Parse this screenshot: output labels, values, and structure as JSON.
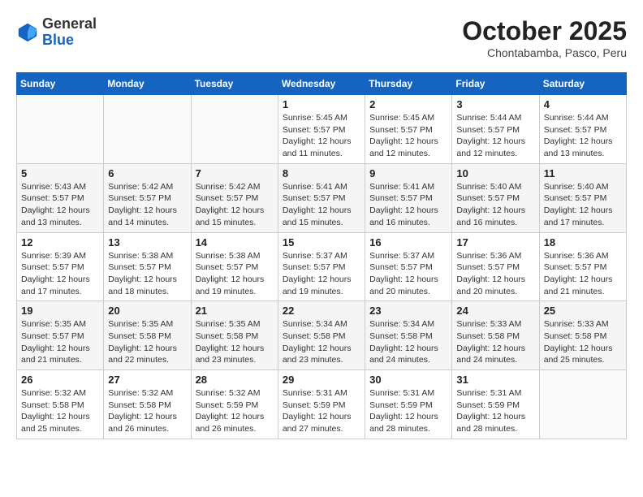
{
  "header": {
    "logo": {
      "general": "General",
      "blue": "Blue"
    },
    "month": "October 2025",
    "location": "Chontabamba, Pasco, Peru"
  },
  "weekdays": [
    "Sunday",
    "Monday",
    "Tuesday",
    "Wednesday",
    "Thursday",
    "Friday",
    "Saturday"
  ],
  "weeks": [
    [
      {
        "day": "",
        "info": ""
      },
      {
        "day": "",
        "info": ""
      },
      {
        "day": "",
        "info": ""
      },
      {
        "day": "1",
        "info": "Sunrise: 5:45 AM\nSunset: 5:57 PM\nDaylight: 12 hours\nand 11 minutes."
      },
      {
        "day": "2",
        "info": "Sunrise: 5:45 AM\nSunset: 5:57 PM\nDaylight: 12 hours\nand 12 minutes."
      },
      {
        "day": "3",
        "info": "Sunrise: 5:44 AM\nSunset: 5:57 PM\nDaylight: 12 hours\nand 12 minutes."
      },
      {
        "day": "4",
        "info": "Sunrise: 5:44 AM\nSunset: 5:57 PM\nDaylight: 12 hours\nand 13 minutes."
      }
    ],
    [
      {
        "day": "5",
        "info": "Sunrise: 5:43 AM\nSunset: 5:57 PM\nDaylight: 12 hours\nand 13 minutes."
      },
      {
        "day": "6",
        "info": "Sunrise: 5:42 AM\nSunset: 5:57 PM\nDaylight: 12 hours\nand 14 minutes."
      },
      {
        "day": "7",
        "info": "Sunrise: 5:42 AM\nSunset: 5:57 PM\nDaylight: 12 hours\nand 15 minutes."
      },
      {
        "day": "8",
        "info": "Sunrise: 5:41 AM\nSunset: 5:57 PM\nDaylight: 12 hours\nand 15 minutes."
      },
      {
        "day": "9",
        "info": "Sunrise: 5:41 AM\nSunset: 5:57 PM\nDaylight: 12 hours\nand 16 minutes."
      },
      {
        "day": "10",
        "info": "Sunrise: 5:40 AM\nSunset: 5:57 PM\nDaylight: 12 hours\nand 16 minutes."
      },
      {
        "day": "11",
        "info": "Sunrise: 5:40 AM\nSunset: 5:57 PM\nDaylight: 12 hours\nand 17 minutes."
      }
    ],
    [
      {
        "day": "12",
        "info": "Sunrise: 5:39 AM\nSunset: 5:57 PM\nDaylight: 12 hours\nand 17 minutes."
      },
      {
        "day": "13",
        "info": "Sunrise: 5:38 AM\nSunset: 5:57 PM\nDaylight: 12 hours\nand 18 minutes."
      },
      {
        "day": "14",
        "info": "Sunrise: 5:38 AM\nSunset: 5:57 PM\nDaylight: 12 hours\nand 19 minutes."
      },
      {
        "day": "15",
        "info": "Sunrise: 5:37 AM\nSunset: 5:57 PM\nDaylight: 12 hours\nand 19 minutes."
      },
      {
        "day": "16",
        "info": "Sunrise: 5:37 AM\nSunset: 5:57 PM\nDaylight: 12 hours\nand 20 minutes."
      },
      {
        "day": "17",
        "info": "Sunrise: 5:36 AM\nSunset: 5:57 PM\nDaylight: 12 hours\nand 20 minutes."
      },
      {
        "day": "18",
        "info": "Sunrise: 5:36 AM\nSunset: 5:57 PM\nDaylight: 12 hours\nand 21 minutes."
      }
    ],
    [
      {
        "day": "19",
        "info": "Sunrise: 5:35 AM\nSunset: 5:57 PM\nDaylight: 12 hours\nand 21 minutes."
      },
      {
        "day": "20",
        "info": "Sunrise: 5:35 AM\nSunset: 5:58 PM\nDaylight: 12 hours\nand 22 minutes."
      },
      {
        "day": "21",
        "info": "Sunrise: 5:35 AM\nSunset: 5:58 PM\nDaylight: 12 hours\nand 23 minutes."
      },
      {
        "day": "22",
        "info": "Sunrise: 5:34 AM\nSunset: 5:58 PM\nDaylight: 12 hours\nand 23 minutes."
      },
      {
        "day": "23",
        "info": "Sunrise: 5:34 AM\nSunset: 5:58 PM\nDaylight: 12 hours\nand 24 minutes."
      },
      {
        "day": "24",
        "info": "Sunrise: 5:33 AM\nSunset: 5:58 PM\nDaylight: 12 hours\nand 24 minutes."
      },
      {
        "day": "25",
        "info": "Sunrise: 5:33 AM\nSunset: 5:58 PM\nDaylight: 12 hours\nand 25 minutes."
      }
    ],
    [
      {
        "day": "26",
        "info": "Sunrise: 5:32 AM\nSunset: 5:58 PM\nDaylight: 12 hours\nand 25 minutes."
      },
      {
        "day": "27",
        "info": "Sunrise: 5:32 AM\nSunset: 5:58 PM\nDaylight: 12 hours\nand 26 minutes."
      },
      {
        "day": "28",
        "info": "Sunrise: 5:32 AM\nSunset: 5:59 PM\nDaylight: 12 hours\nand 26 minutes."
      },
      {
        "day": "29",
        "info": "Sunrise: 5:31 AM\nSunset: 5:59 PM\nDaylight: 12 hours\nand 27 minutes."
      },
      {
        "day": "30",
        "info": "Sunrise: 5:31 AM\nSunset: 5:59 PM\nDaylight: 12 hours\nand 28 minutes."
      },
      {
        "day": "31",
        "info": "Sunrise: 5:31 AM\nSunset: 5:59 PM\nDaylight: 12 hours\nand 28 minutes."
      },
      {
        "day": "",
        "info": ""
      }
    ]
  ]
}
